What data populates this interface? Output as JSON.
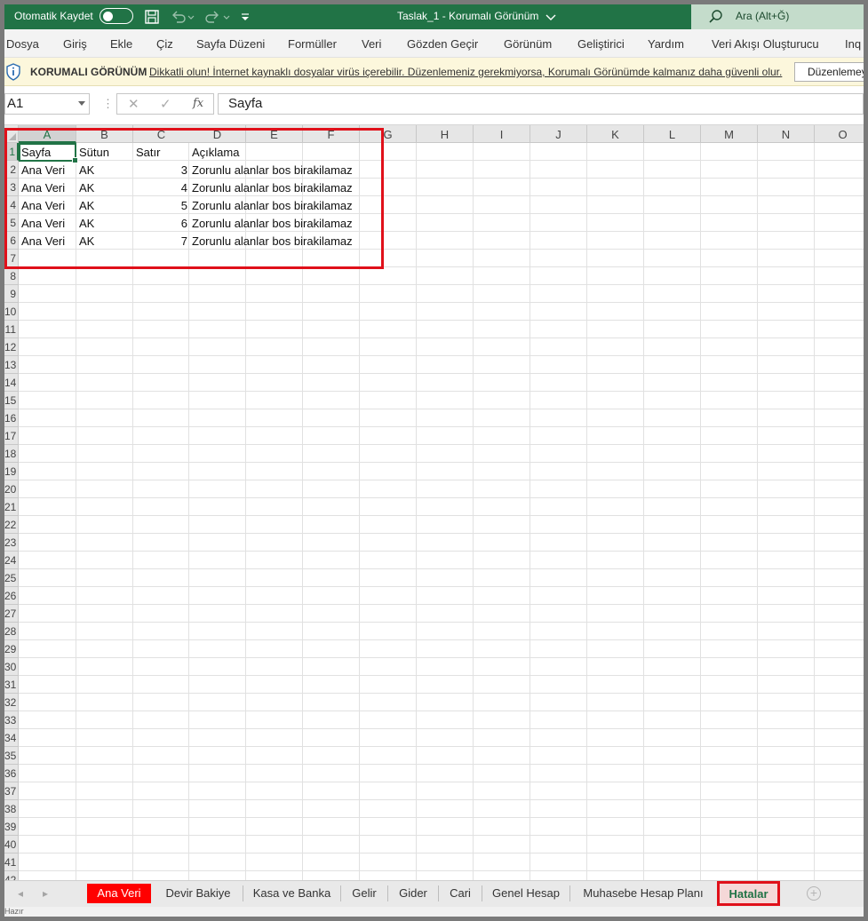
{
  "titlebar": {
    "autosave_label": "Otomatik Kaydet",
    "document_title": "Taslak_1  -  Korumalı Görünüm",
    "search_placeholder": "Ara (Alt+Ğ)",
    "accent_color": "#217346"
  },
  "menu": {
    "items": [
      "Dosya",
      "Giriş",
      "Ekle",
      "Çiz",
      "Sayfa Düzeni",
      "Formüller",
      "Veri",
      "Gözden Geçir",
      "Görünüm",
      "Geliştirici",
      "Yardım",
      "Veri Akışı Oluşturucu",
      "Inq"
    ]
  },
  "protected_view": {
    "label": "KORUMALI GÖRÜNÜM",
    "message": "Dikkatli olun! İnternet kaynaklı dosyalar virüs içerebilir. Düzenlemeniz gerekmiyorsa, Korumalı Görünümde kalmanız daha güvenli olur.",
    "enable_button": "Düzenlemeyi Etkinleştir"
  },
  "formula_bar": {
    "name_box": "A1",
    "cancel_icon": "✕",
    "enter_icon": "✓",
    "fx_label": "fx",
    "formula": "Sayfa"
  },
  "columns": [
    "A",
    "B",
    "C",
    "D",
    "E",
    "F",
    "G",
    "H",
    "I",
    "J",
    "K",
    "L",
    "M",
    "N",
    "O"
  ],
  "rows": [
    "1",
    "2",
    "3",
    "4",
    "5",
    "6",
    "7",
    "8",
    "9",
    "10",
    "11",
    "12",
    "13",
    "14",
    "15",
    "16",
    "17",
    "18",
    "19",
    "20",
    "21",
    "22",
    "23",
    "24",
    "25",
    "26",
    "27",
    "28",
    "29",
    "30",
    "31",
    "32",
    "33",
    "34",
    "35",
    "36",
    "37",
    "38",
    "39",
    "40",
    "41",
    "42"
  ],
  "sheet": {
    "headers": [
      "Sayfa",
      "Sütun",
      "Satır",
      "Açıklama"
    ],
    "data": [
      [
        "Ana Veri",
        "AK",
        "3",
        "Zorunlu alanlar bos birakilamaz"
      ],
      [
        "Ana Veri",
        "AK",
        "4",
        "Zorunlu alanlar bos birakilamaz"
      ],
      [
        "Ana Veri",
        "AK",
        "5",
        "Zorunlu alanlar bos birakilamaz"
      ],
      [
        "Ana Veri",
        "AK",
        "6",
        "Zorunlu alanlar bos birakilamaz"
      ],
      [
        "Ana Veri",
        "AK",
        "7",
        "Zorunlu alanlar bos birakilamaz"
      ]
    ]
  },
  "tabs": [
    "Ana Veri",
    "Devir Bakiye",
    "Kasa ve Banka",
    "Gelir",
    "Gider",
    "Cari",
    "Genel Hesap",
    "Muhasebe Hesap Planı",
    "Hatalar"
  ],
  "active_tab": "Hatalar",
  "highlight_color": "#e0101a",
  "status": "Hazır"
}
